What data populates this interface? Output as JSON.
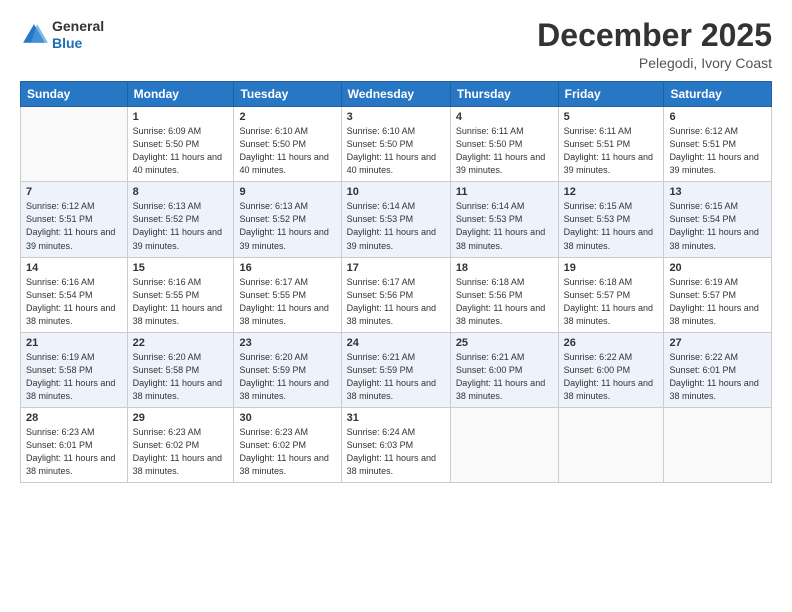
{
  "header": {
    "logo_general": "General",
    "logo_blue": "Blue",
    "month_title": "December 2025",
    "location": "Pelegodi, Ivory Coast"
  },
  "columns": [
    "Sunday",
    "Monday",
    "Tuesday",
    "Wednesday",
    "Thursday",
    "Friday",
    "Saturday"
  ],
  "weeks": [
    [
      {
        "day": "",
        "text": ""
      },
      {
        "day": "1",
        "text": "Sunrise: 6:09 AM\nSunset: 5:50 PM\nDaylight: 11 hours and 40 minutes."
      },
      {
        "day": "2",
        "text": "Sunrise: 6:10 AM\nSunset: 5:50 PM\nDaylight: 11 hours and 40 minutes."
      },
      {
        "day": "3",
        "text": "Sunrise: 6:10 AM\nSunset: 5:50 PM\nDaylight: 11 hours and 40 minutes."
      },
      {
        "day": "4",
        "text": "Sunrise: 6:11 AM\nSunset: 5:50 PM\nDaylight: 11 hours and 39 minutes."
      },
      {
        "day": "5",
        "text": "Sunrise: 6:11 AM\nSunset: 5:51 PM\nDaylight: 11 hours and 39 minutes."
      },
      {
        "day": "6",
        "text": "Sunrise: 6:12 AM\nSunset: 5:51 PM\nDaylight: 11 hours and 39 minutes."
      }
    ],
    [
      {
        "day": "7",
        "text": "Sunrise: 6:12 AM\nSunset: 5:51 PM\nDaylight: 11 hours and 39 minutes."
      },
      {
        "day": "8",
        "text": "Sunrise: 6:13 AM\nSunset: 5:52 PM\nDaylight: 11 hours and 39 minutes."
      },
      {
        "day": "9",
        "text": "Sunrise: 6:13 AM\nSunset: 5:52 PM\nDaylight: 11 hours and 39 minutes."
      },
      {
        "day": "10",
        "text": "Sunrise: 6:14 AM\nSunset: 5:53 PM\nDaylight: 11 hours and 39 minutes."
      },
      {
        "day": "11",
        "text": "Sunrise: 6:14 AM\nSunset: 5:53 PM\nDaylight: 11 hours and 38 minutes."
      },
      {
        "day": "12",
        "text": "Sunrise: 6:15 AM\nSunset: 5:53 PM\nDaylight: 11 hours and 38 minutes."
      },
      {
        "day": "13",
        "text": "Sunrise: 6:15 AM\nSunset: 5:54 PM\nDaylight: 11 hours and 38 minutes."
      }
    ],
    [
      {
        "day": "14",
        "text": "Sunrise: 6:16 AM\nSunset: 5:54 PM\nDaylight: 11 hours and 38 minutes."
      },
      {
        "day": "15",
        "text": "Sunrise: 6:16 AM\nSunset: 5:55 PM\nDaylight: 11 hours and 38 minutes."
      },
      {
        "day": "16",
        "text": "Sunrise: 6:17 AM\nSunset: 5:55 PM\nDaylight: 11 hours and 38 minutes."
      },
      {
        "day": "17",
        "text": "Sunrise: 6:17 AM\nSunset: 5:56 PM\nDaylight: 11 hours and 38 minutes."
      },
      {
        "day": "18",
        "text": "Sunrise: 6:18 AM\nSunset: 5:56 PM\nDaylight: 11 hours and 38 minutes."
      },
      {
        "day": "19",
        "text": "Sunrise: 6:18 AM\nSunset: 5:57 PM\nDaylight: 11 hours and 38 minutes."
      },
      {
        "day": "20",
        "text": "Sunrise: 6:19 AM\nSunset: 5:57 PM\nDaylight: 11 hours and 38 minutes."
      }
    ],
    [
      {
        "day": "21",
        "text": "Sunrise: 6:19 AM\nSunset: 5:58 PM\nDaylight: 11 hours and 38 minutes."
      },
      {
        "day": "22",
        "text": "Sunrise: 6:20 AM\nSunset: 5:58 PM\nDaylight: 11 hours and 38 minutes."
      },
      {
        "day": "23",
        "text": "Sunrise: 6:20 AM\nSunset: 5:59 PM\nDaylight: 11 hours and 38 minutes."
      },
      {
        "day": "24",
        "text": "Sunrise: 6:21 AM\nSunset: 5:59 PM\nDaylight: 11 hours and 38 minutes."
      },
      {
        "day": "25",
        "text": "Sunrise: 6:21 AM\nSunset: 6:00 PM\nDaylight: 11 hours and 38 minutes."
      },
      {
        "day": "26",
        "text": "Sunrise: 6:22 AM\nSunset: 6:00 PM\nDaylight: 11 hours and 38 minutes."
      },
      {
        "day": "27",
        "text": "Sunrise: 6:22 AM\nSunset: 6:01 PM\nDaylight: 11 hours and 38 minutes."
      }
    ],
    [
      {
        "day": "28",
        "text": "Sunrise: 6:23 AM\nSunset: 6:01 PM\nDaylight: 11 hours and 38 minutes."
      },
      {
        "day": "29",
        "text": "Sunrise: 6:23 AM\nSunset: 6:02 PM\nDaylight: 11 hours and 38 minutes."
      },
      {
        "day": "30",
        "text": "Sunrise: 6:23 AM\nSunset: 6:02 PM\nDaylight: 11 hours and 38 minutes."
      },
      {
        "day": "31",
        "text": "Sunrise: 6:24 AM\nSunset: 6:03 PM\nDaylight: 11 hours and 38 minutes."
      },
      {
        "day": "",
        "text": ""
      },
      {
        "day": "",
        "text": ""
      },
      {
        "day": "",
        "text": ""
      }
    ]
  ]
}
